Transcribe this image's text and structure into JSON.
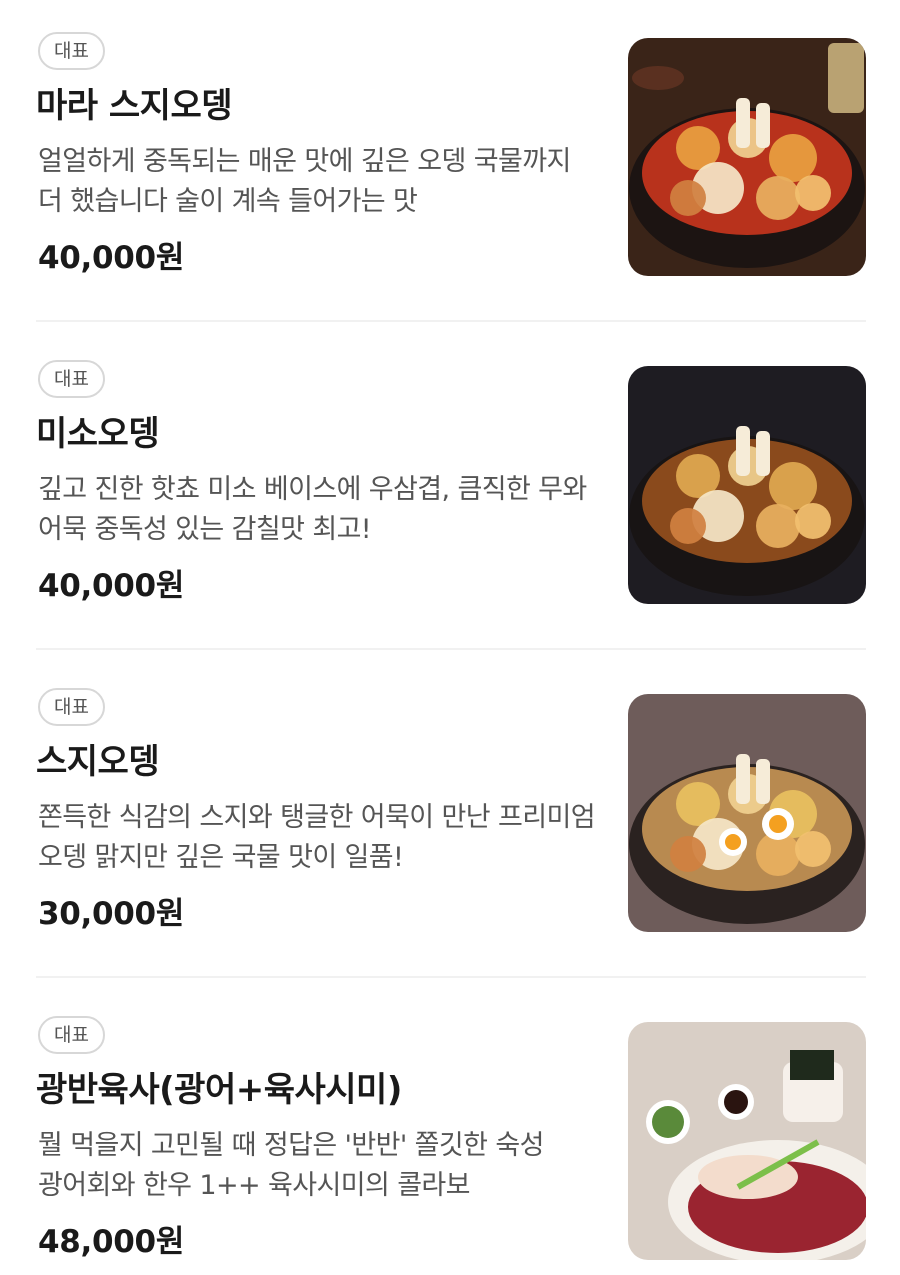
{
  "badge_label": "대표",
  "items": [
    {
      "name": "마라 스지오뎅",
      "description": "얼얼하게 중독되는 매운 맛에 깊은 오뎅 국물까지 더 했습니다 술이 계속 들어가는 맛",
      "price": "40,000원",
      "image": "mala-suji-oden-photo",
      "palette": {
        "bg": "#3a2418",
        "pot": "#1c1412",
        "broth": "#b8321c",
        "accent": "#e8a040"
      }
    },
    {
      "name": "미소오뎅",
      "description": "깊고 진한 핫쵸 미소 베이스에 우삼겹, 큼직한 무와 어묵 중독성 있는 감칠맛 최고!",
      "price": "40,000원",
      "image": "miso-oden-photo",
      "palette": {
        "bg": "#1e1c22",
        "pot": "#181414",
        "broth": "#8a4a1c",
        "accent": "#e0a850"
      }
    },
    {
      "name": "스지오뎅",
      "description": "쫀득한 식감의 스지와 탱글한 어묵이 만난 프리미엄 오뎅 맑지만 깊은 국물 맛이 일품!",
      "price": "30,000원",
      "image": "suji-oden-photo",
      "palette": {
        "bg": "#6e5c5a",
        "pot": "#2a2220",
        "broth": "#b88a50",
        "accent": "#e8c060"
      }
    },
    {
      "name": "광반육사(광어+육사시미)",
      "description": "뭘 먹을지 고민될 때 정답은 '반반' 쫄깃한 숙성 광어회와 한우 1++ 육사시미의 콜라보",
      "price": "48,000원",
      "image": "halibut-yukhoe-platter-photo",
      "palette": {
        "bg": "#d9cfc6",
        "pot": "#f4f0ea",
        "broth": "#9a2430",
        "accent": "#5a8a3a"
      }
    }
  ]
}
